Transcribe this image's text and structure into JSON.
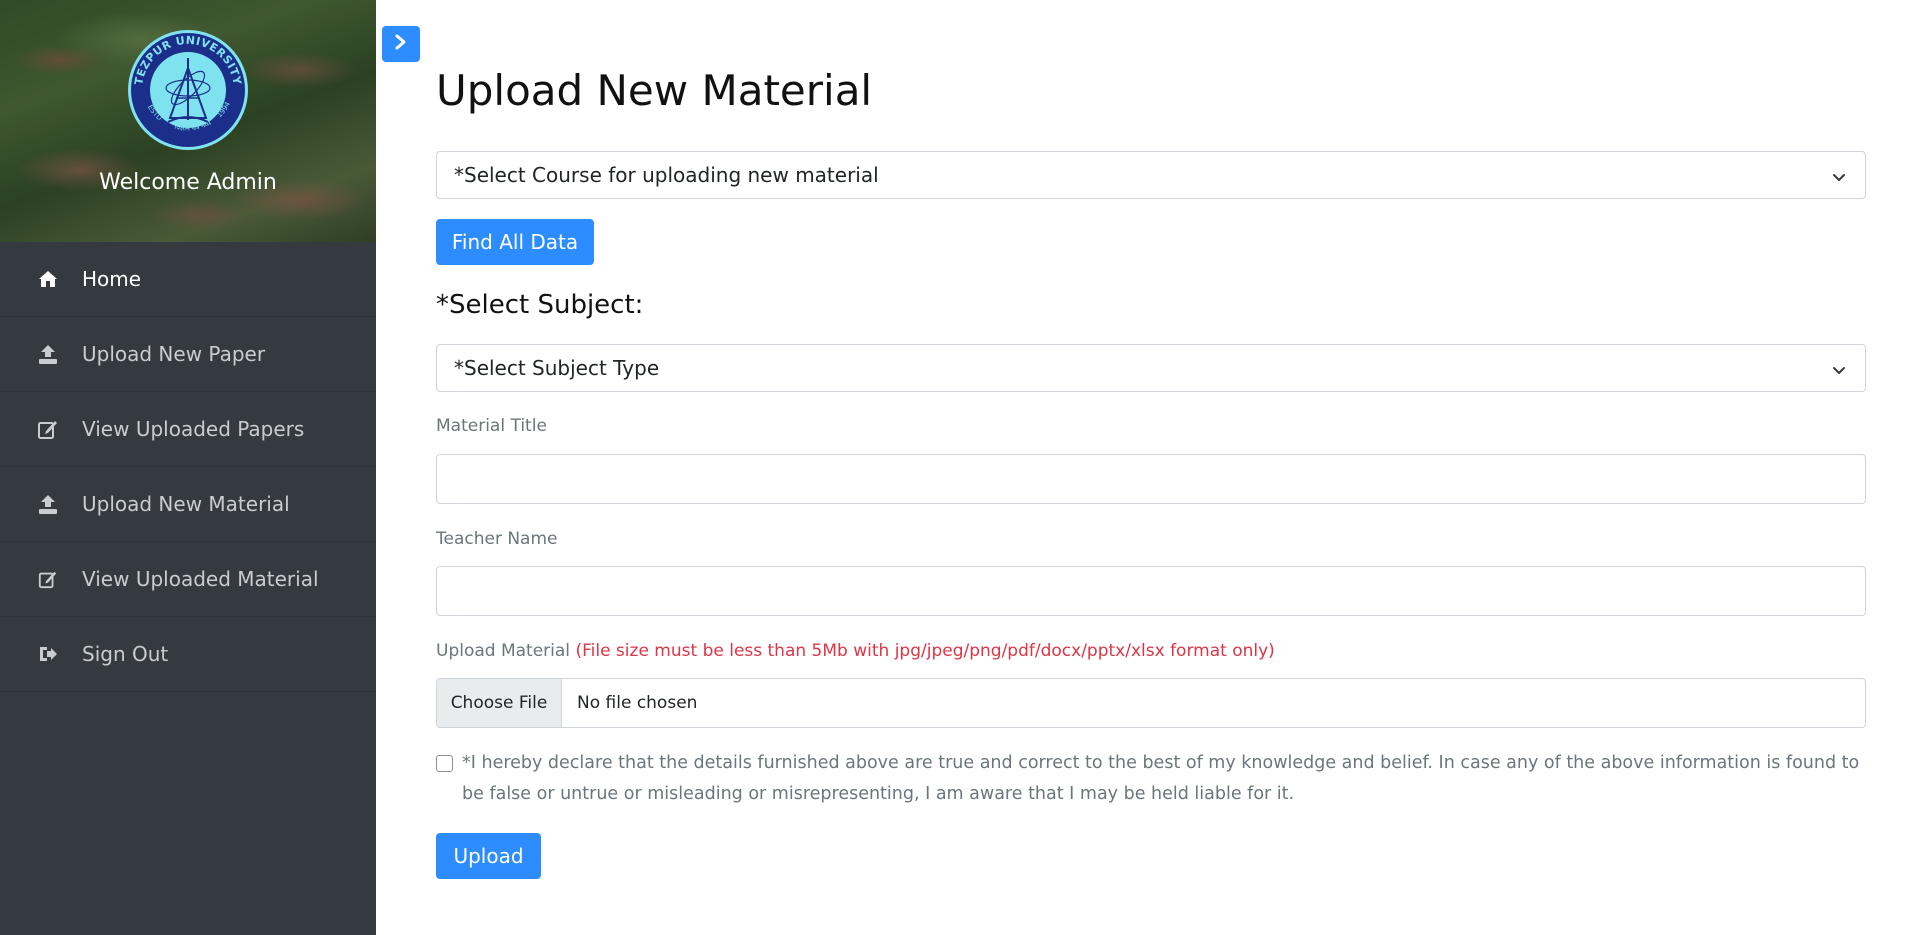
{
  "sidebar": {
    "logo": {
      "ring_text": "TEZPUR UNIVERSITY",
      "estd_text": "ESTD",
      "year_text": "1994",
      "motto_text": "विज्ञान यत्रं नव्यं",
      "colors": {
        "ring": "#1b2f8a",
        "inner": "#7fe3ef"
      }
    },
    "welcome": "Welcome Admin",
    "items": [
      {
        "label": "Home",
        "icon": "home-icon"
      },
      {
        "label": "Upload New Paper",
        "icon": "upload-icon"
      },
      {
        "label": "View Uploaded Papers",
        "icon": "edit-icon"
      },
      {
        "label": "Upload New Material",
        "icon": "upload-icon"
      },
      {
        "label": "View Uploaded Material",
        "icon": "edit-icon"
      },
      {
        "label": "Sign Out",
        "icon": "sign-out-icon"
      }
    ]
  },
  "main": {
    "title": "Upload New Material",
    "course_select": "*Select Course for uploading new material",
    "find_button": "Find All Data",
    "subject_heading": "*Select Subject:",
    "subject_select": "*Select Subject Type",
    "material_title_label": "Material Title",
    "material_title_value": "",
    "teacher_name_label": "Teacher Name",
    "teacher_name_value": "",
    "upload_label": "Upload Material",
    "upload_note": "(File size must be less than 5Mb with jpg/jpeg/png/pdf/docx/pptx/xlsx format only)",
    "choose_file": "Choose File",
    "no_file": "No file chosen",
    "declaration": "*I hereby declare that the details furnished above are true and correct to the best of my knowledge and belief. In case any of the above information is found to be false or untrue or misleading or misrepresenting, I am aware that I may be held liable for it.",
    "upload_button": "Upload"
  },
  "colors": {
    "primary": "#2d8cff",
    "sidebar": "#343a40",
    "warning": "#dc3545"
  }
}
